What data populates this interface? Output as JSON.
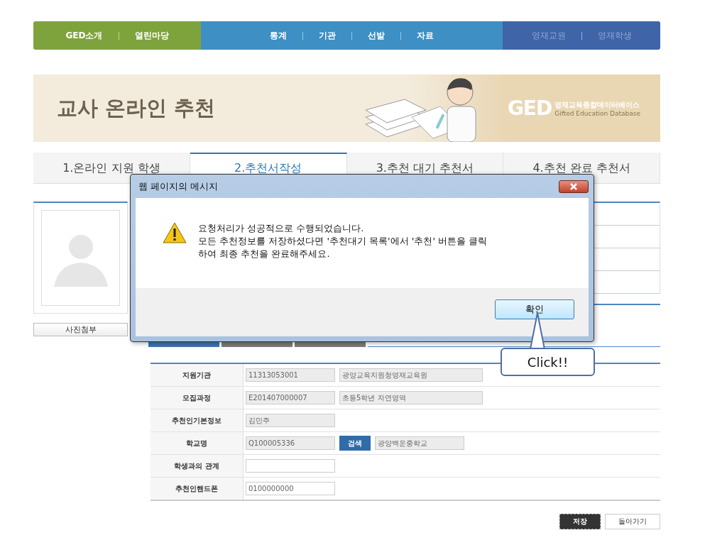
{
  "nav": {
    "groups": [
      {
        "color": "#7ea33c",
        "items": [
          {
            "label": "GED소개",
            "disabled": false
          },
          {
            "label": "열린마당",
            "disabled": false
          }
        ]
      },
      {
        "color": "#3d8fc4",
        "items": [
          {
            "label": "통계",
            "disabled": false
          },
          {
            "label": "기관",
            "disabled": false
          },
          {
            "label": "선발",
            "disabled": false
          },
          {
            "label": "자료",
            "disabled": false
          }
        ]
      },
      {
        "color": "#3f64a8",
        "items": [
          {
            "label": "영재교원",
            "disabled": true
          },
          {
            "label": "영재학생",
            "disabled": true
          }
        ]
      }
    ]
  },
  "banner": {
    "title": "교사 온라인 추천",
    "logo": "GED",
    "logo_korean": "영재교육종합데이터베이스",
    "logo_english": "Gifted Education Database"
  },
  "tabs": [
    {
      "label": "1.온라인 지원 학생",
      "selected": false
    },
    {
      "label": "2.추천서작성",
      "selected": true
    },
    {
      "label": "3.추천 대기 추천서",
      "selected": false
    },
    {
      "label": "4.추천 완료 추천서",
      "selected": false
    }
  ],
  "photo_button": "사진첨부",
  "sub_tabs": [
    {
      "selected": true
    },
    {
      "selected": false
    },
    {
      "selected": false
    }
  ],
  "form": {
    "rows": [
      {
        "label": "지원기관",
        "parts": [
          {
            "kind": "field",
            "value": "11313053001",
            "readonly": true
          },
          {
            "kind": "long_field",
            "value": "광양교육지원청영재교육원",
            "readonly": true
          }
        ]
      },
      {
        "label": "모집과정",
        "parts": [
          {
            "kind": "field",
            "value": "E201407000007",
            "readonly": true
          },
          {
            "kind": "long_field",
            "value": "초등5학년 자연영역",
            "readonly": true
          }
        ]
      },
      {
        "label": "추천인기본정보",
        "parts": [
          {
            "kind": "field",
            "value": "김민주",
            "readonly": true
          }
        ]
      },
      {
        "label": "학교명",
        "parts": [
          {
            "kind": "field",
            "value": "Q100005336",
            "readonly": true
          },
          {
            "kind": "button",
            "label": "검색"
          },
          {
            "kind": "field",
            "value": "광양백운중학교",
            "readonly": true
          }
        ]
      },
      {
        "label": "학생과의 관계",
        "parts": [
          {
            "kind": "field",
            "readonly": false
          }
        ]
      },
      {
        "label": "추천인핸드폰",
        "parts": [
          {
            "kind": "field",
            "value": "0100000000",
            "readonly": false
          }
        ]
      }
    ]
  },
  "buttons": [
    {
      "label": "저장",
      "kind": "primary"
    },
    {
      "label": "돌아가기",
      "kind": "secondary"
    }
  ],
  "dialog": {
    "title": "웹 페이지의 메시지",
    "message_lines": [
      "요청처리가 성공적으로 수행되었습니다.",
      "모든 추천정보를 저장하셨다면 '추천대기 목록'에서 '추천' 버튼을 클릭",
      "하여 최종 추천을 완료해주세요."
    ],
    "button": "확인"
  },
  "callout": {
    "text": "Click!!"
  }
}
